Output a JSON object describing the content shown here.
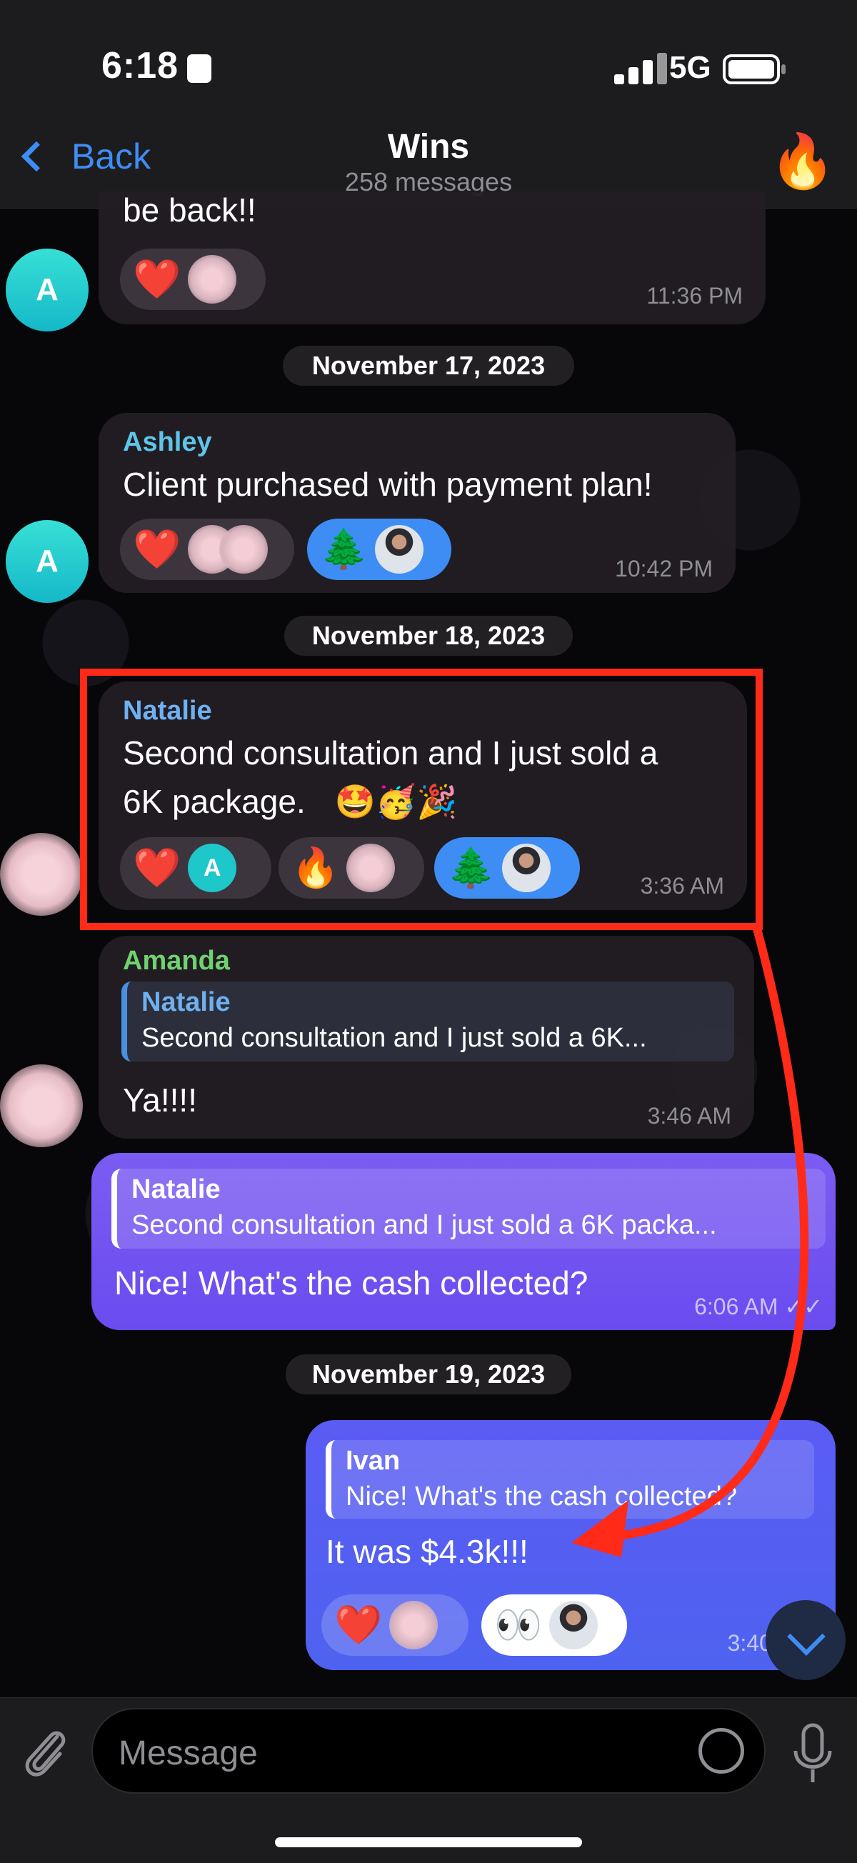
{
  "status_bar": {
    "time": "6:18",
    "network": "5G"
  },
  "nav": {
    "back_label": "Back",
    "title": "Wins",
    "subtitle": "258 messages",
    "avatar_emoji": "🔥"
  },
  "colors": {
    "accent": "#3e8df5",
    "highlight": "#ff2a18",
    "outgoing": "#6a4cf0",
    "ashley": "#5ec4e8",
    "natalie": "#6fb0f0",
    "amanda": "#6fd26f"
  },
  "messages": [
    {
      "text": "be back!!",
      "time": "11:36 PM",
      "reactions": [
        "heart-icon",
        "blurred-avatar"
      ]
    },
    {
      "date": "November 17, 2023"
    },
    {
      "sender": "Ashley",
      "text": "Client purchased with payment plan!",
      "time": "10:42 PM",
      "avatar_letter": "A",
      "reactions": [
        "heart-icon",
        "tree-icon"
      ]
    },
    {
      "date": "November 18, 2023"
    },
    {
      "sender": "Natalie",
      "text_line1": "Second consultation and I just sold a",
      "text_line2": "6K package.",
      "emojis": "🤩🥳🎉",
      "time": "3:36 AM",
      "reaction_letter": "A",
      "reactions": [
        "heart-icon",
        "fire-icon",
        "tree-icon"
      ]
    },
    {
      "sender": "Amanda",
      "reply_name": "Natalie",
      "reply_text": "Second consultation and I just sold a 6K...",
      "text": "Ya!!!!",
      "time": "3:46 AM"
    },
    {
      "reply_name": "Natalie",
      "reply_text": "Second consultation and I just sold a 6K packa...",
      "text": "Nice! What's the cash collected?",
      "time": "6:06 AM"
    },
    {
      "date": "November 19, 2023"
    },
    {
      "reply_name": "Ivan",
      "reply_text": "Nice! What's the cash collected?",
      "text": "It was $4.3k!!!",
      "time": "3:40 AM",
      "reactions": [
        "heart-icon",
        "eyes-icon"
      ]
    }
  ],
  "emoji": {
    "heart": "❤️",
    "tree": "🌲",
    "fire": "🔥",
    "eyes": "👀"
  },
  "input": {
    "placeholder": "Message"
  }
}
